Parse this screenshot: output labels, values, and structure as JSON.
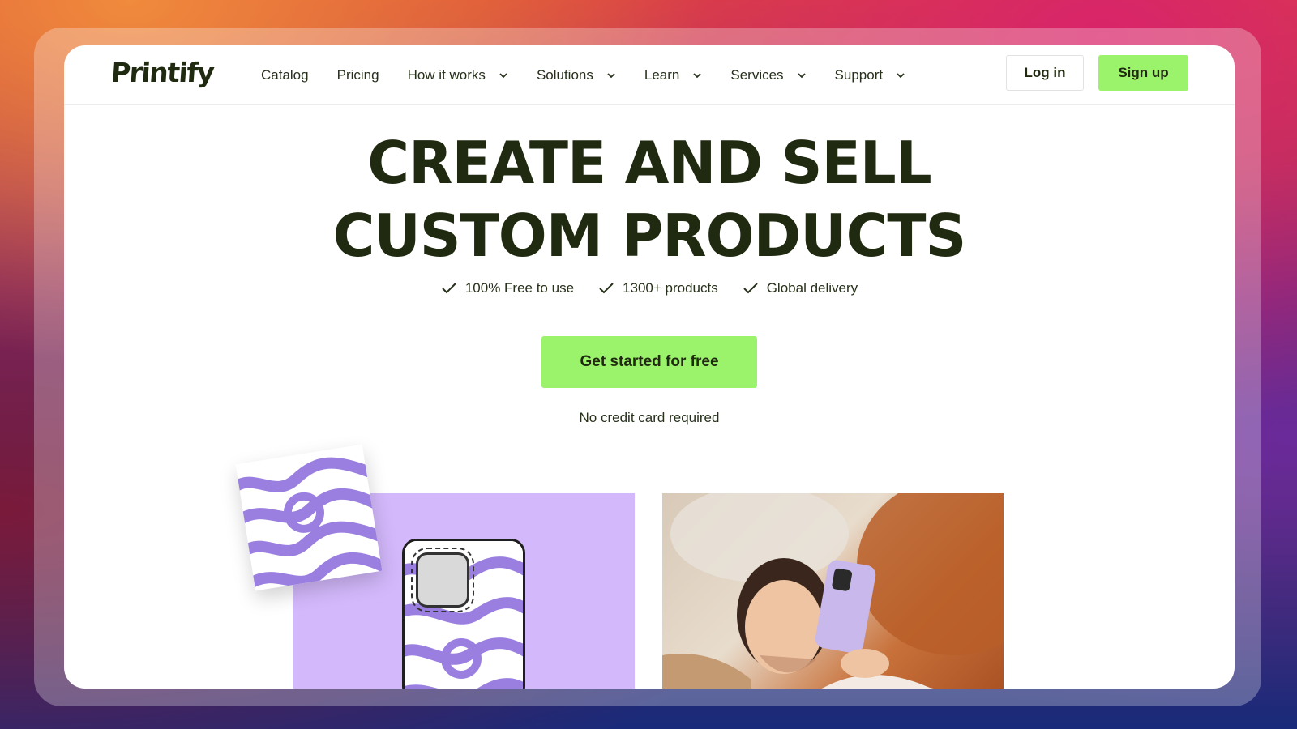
{
  "brand": {
    "name": "Printify",
    "accent": "#9bf26b",
    "text_color": "#1f2a10"
  },
  "nav": {
    "items": [
      {
        "label": "Catalog",
        "has_dropdown": false
      },
      {
        "label": "Pricing",
        "has_dropdown": false
      },
      {
        "label": "How it works",
        "has_dropdown": true
      },
      {
        "label": "Solutions",
        "has_dropdown": true
      },
      {
        "label": "Learn",
        "has_dropdown": true
      },
      {
        "label": "Services",
        "has_dropdown": true
      },
      {
        "label": "Support",
        "has_dropdown": true
      }
    ],
    "login_label": "Log in",
    "signup_label": "Sign up"
  },
  "hero": {
    "title_line1": "CREATE AND SELL",
    "title_line2": "CUSTOM PRODUCTS",
    "features": [
      "100% Free to use",
      "1300+ products",
      "Global delivery"
    ],
    "cta_label": "Get started for free",
    "note": "No credit card required"
  },
  "images": {
    "left": {
      "background": "#d3b8fb",
      "pattern_color": "#9a7fe0"
    },
    "right": {
      "description_icon": "photo-woman-phone"
    }
  }
}
